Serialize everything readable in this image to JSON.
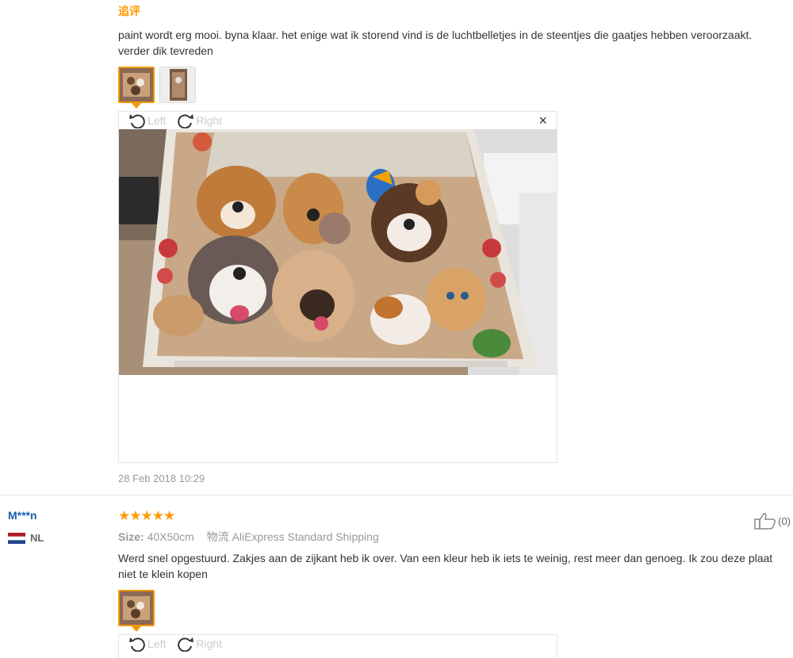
{
  "review1": {
    "followup_tag": "追评",
    "text": "paint wordt erg mooi. byna klaar. het enige wat ik storend vind is de luchtbelletjes in de steentjes die gaatjes hebben veroorzaakt. verder dik tevreden",
    "viewer": {
      "rotate_left_label": "Left",
      "rotate_right_label": "Right",
      "close_label": "×"
    },
    "date": "28 Feb 2018 10:29"
  },
  "review2": {
    "username": "M***n",
    "country": "NL",
    "stars": "★★★★★",
    "size_label": "Size:",
    "size_value": "40X50cm",
    "shipping_label": "物流",
    "shipping_value": "AliExpress Standard Shipping",
    "helpful_count": "(0)",
    "text": "Werd snel opgestuurd. Zakjes aan de zijkant heb ik over. Van een kleur heb ik iets te weinig, rest meer dan genoeg. Ik zou deze plaat niet te klein kopen",
    "viewer": {
      "rotate_left_label": "Left",
      "rotate_right_label": "Right"
    }
  },
  "colors": {
    "accent": "#f39800",
    "username": "#1d5fad",
    "star": "#ff9900"
  }
}
